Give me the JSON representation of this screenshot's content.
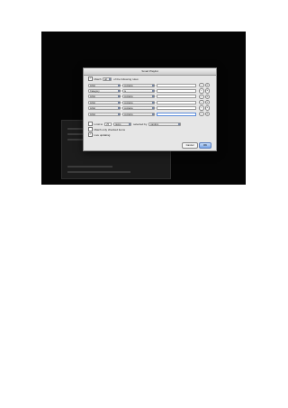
{
  "dialog": {
    "title": "Smart Playlist",
    "match_label": "Match",
    "match_value": "all",
    "match_suffix": "of the following rules:"
  },
  "rules": [
    {
      "field": "Artist",
      "op": "contains",
      "value": ""
    },
    {
      "field": "Category",
      "op": "is",
      "value": ""
    },
    {
      "field": "Artist",
      "op": "contains",
      "value": ""
    },
    {
      "field": "Artist",
      "op": "contains",
      "value": ""
    },
    {
      "field": "Artist",
      "op": "contains",
      "value": ""
    },
    {
      "field": "Artist",
      "op": "contains",
      "value": ""
    }
  ],
  "limit": {
    "label": "Limit to",
    "value": "25",
    "unit": "items",
    "selected_by_label": "selected by",
    "selected_by_value": "random"
  },
  "match_checked_label": "Match only checked items",
  "live_updating_label": "Live updating",
  "buttons": {
    "cancel": "Cancel",
    "ok": "OK"
  },
  "icons": {
    "add": "+",
    "remove": "−"
  }
}
